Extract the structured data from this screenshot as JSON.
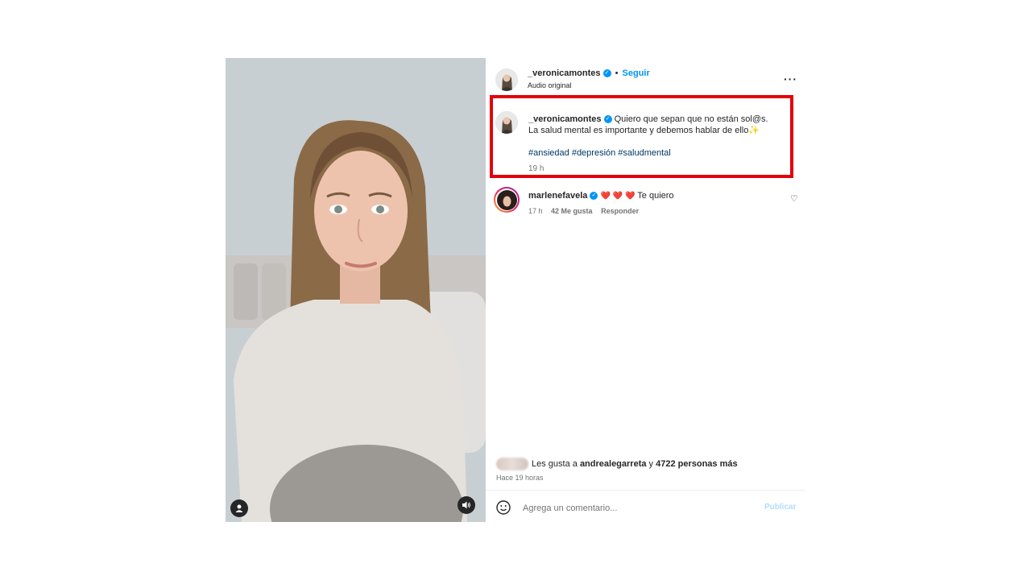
{
  "post": {
    "username": "_veronicamontes",
    "follow_label": "Seguir",
    "audio_label": "Audio original",
    "caption_text": "Quiero que sepan que no están sol@s. La salud mental es importante y debemos hablar de ello",
    "caption_emoji": "✨",
    "hashtags": "#ansiedad #depresión #saludmental",
    "time": "19 h"
  },
  "comment": {
    "username": "marlenefavela",
    "text": "Te quiero",
    "hearts": "❤️ ❤️ ❤️",
    "time": "17 h",
    "likes": "42 Me gusta",
    "reply_label": "Responder"
  },
  "likes_summary": {
    "prefix": "Les gusta a",
    "user": "andrealegarreta",
    "connector": "y",
    "others": "4722 personas más",
    "time_ago": "Hace 19 horas"
  },
  "comment_input": {
    "placeholder": "Agrega un comentario...",
    "publish_label": "Publicar"
  },
  "highlight_color": "#e3000b"
}
